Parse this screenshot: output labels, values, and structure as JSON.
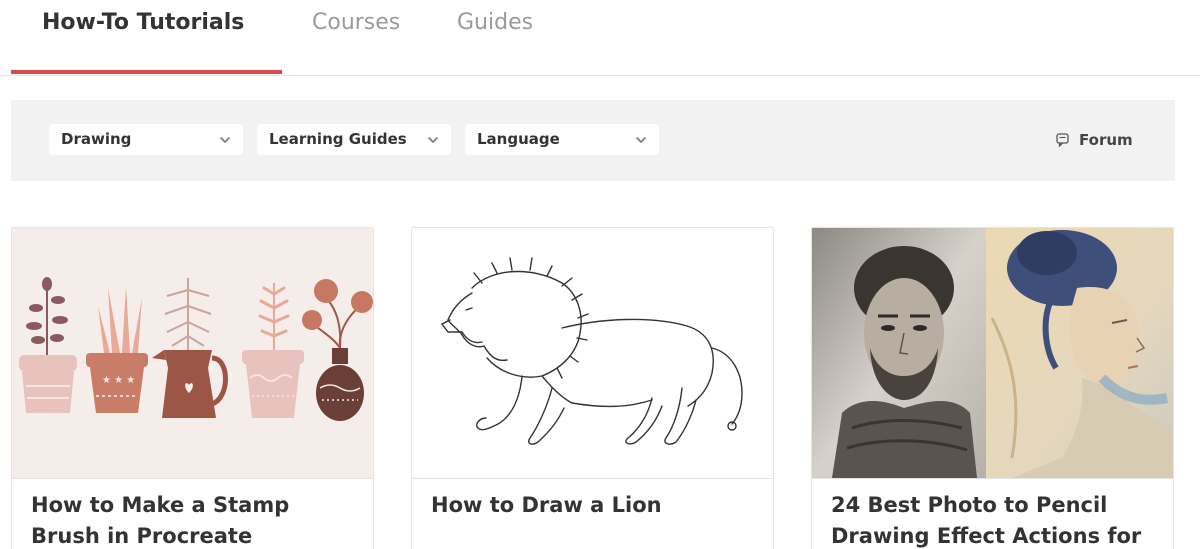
{
  "tabs": [
    {
      "label": "How-To Tutorials",
      "active": true
    },
    {
      "label": "Courses",
      "active": false
    },
    {
      "label": "Guides",
      "active": false
    }
  ],
  "filters": {
    "dropdowns": [
      {
        "label": "Drawing"
      },
      {
        "label": "Learning Guides"
      },
      {
        "label": "Language"
      }
    ],
    "forum_label": "Forum"
  },
  "cards": [
    {
      "title": "How to Make a Stamp Brush in Procreate",
      "thumbnail": "plant-pots-illustration"
    },
    {
      "title": "How to Draw a Lion",
      "thumbnail": "lion-sketch"
    },
    {
      "title": "24 Best Photo to Pencil Drawing Effect Actions for",
      "thumbnail": "pencil-portraits"
    }
  ],
  "colors": {
    "accent": "#d94a4a",
    "filter_bg": "#f2f2f2",
    "active_text": "#333333",
    "inactive_text": "#9a9a9a"
  }
}
